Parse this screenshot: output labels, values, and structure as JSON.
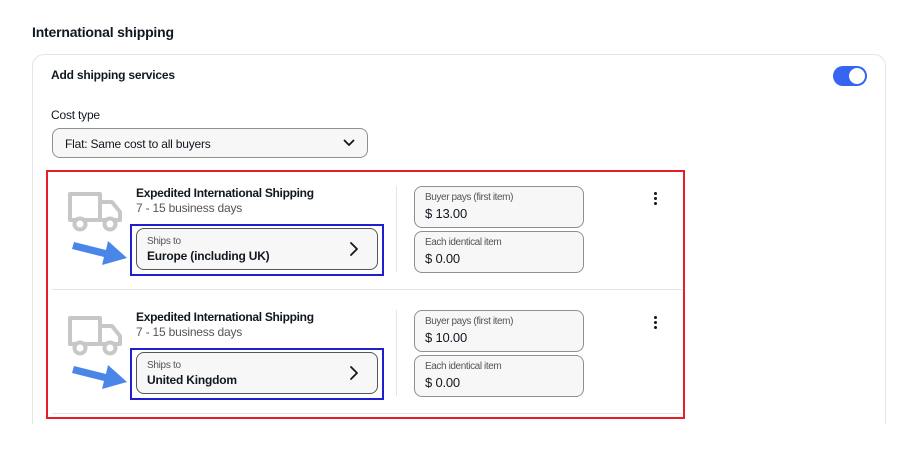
{
  "section": {
    "title": "International shipping"
  },
  "card": {
    "title": "Add shipping services",
    "toggle_on": true,
    "cost_type": {
      "label": "Cost type",
      "selected": "Flat: Same cost to all buyers"
    }
  },
  "services": [
    {
      "title": "Expedited International Shipping",
      "days": "7 - 15 business days",
      "ships_to_label": "Ships to",
      "ships_to_value": "Europe (including UK)",
      "buyer_pays_label": "Buyer pays (first item)",
      "buyer_pays_value": "$ 13.00",
      "each_item_label": "Each identical item",
      "each_item_value": "$ 0.00"
    },
    {
      "title": "Expedited International Shipping",
      "days": "7 - 15 business days",
      "ships_to_label": "Ships to",
      "ships_to_value": "United Kingdom",
      "buyer_pays_label": "Buyer pays (first item)",
      "buyer_pays_value": "$ 10.00",
      "each_item_label": "Each identical item",
      "each_item_value": "$ 0.00"
    }
  ],
  "colors": {
    "accent": "#3665f3",
    "annotation_red": "#e61e25",
    "annotation_blue": "#1f1fd1",
    "arrow_blue": "#4a86e8"
  }
}
